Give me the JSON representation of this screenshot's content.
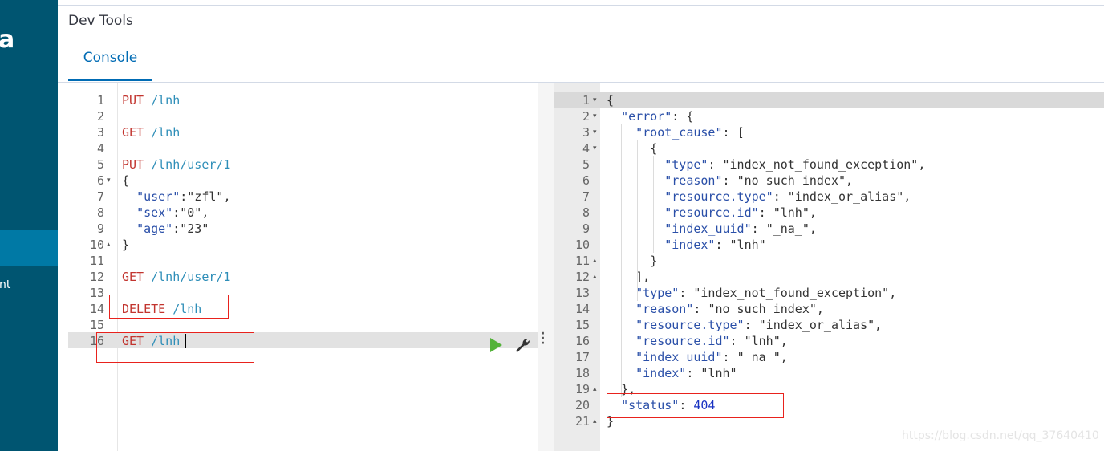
{
  "sidebar": {
    "logo_fragment": "a",
    "nav_fragment": "nt",
    "colors": {
      "background": "#005571",
      "active": "#0079a5"
    }
  },
  "header": {
    "title": "Dev Tools",
    "tabs": [
      {
        "label": "Console",
        "active": true
      }
    ],
    "accent_color": "#006bb4"
  },
  "request_editor": {
    "lines": [
      {
        "n": "1",
        "method": "PUT",
        "path": " /lnh"
      },
      {
        "n": "2"
      },
      {
        "n": "3",
        "method": "GET",
        "path": " /lnh"
      },
      {
        "n": "4"
      },
      {
        "n": "5",
        "method": "PUT",
        "path": " /lnh/user/1"
      },
      {
        "n": "6",
        "text": "{",
        "fold": "open"
      },
      {
        "n": "7",
        "text": "  \"user\":\"zfl\","
      },
      {
        "n": "8",
        "text": "  \"sex\":\"0\","
      },
      {
        "n": "9",
        "text": "  \"age\":\"23\""
      },
      {
        "n": "10",
        "text": "}",
        "fold": "close"
      },
      {
        "n": "11"
      },
      {
        "n": "12",
        "method": "GET",
        "path": " /lnh/user/1"
      },
      {
        "n": "13"
      },
      {
        "n": "14",
        "method": "DELETE",
        "path": " /lnh"
      },
      {
        "n": "15"
      },
      {
        "n": "16",
        "method": "GET",
        "path": " /lnh",
        "active": true
      }
    ],
    "actions": {
      "run_icon": "play-icon",
      "settings_icon": "wrench-icon"
    }
  },
  "response_editor": {
    "lines": [
      {
        "n": "1",
        "text": "{",
        "fold": "open"
      },
      {
        "n": "2",
        "text": "  \"error\": {",
        "fold": "open"
      },
      {
        "n": "3",
        "text": "    \"root_cause\": [",
        "fold": "open"
      },
      {
        "n": "4",
        "text": "      {",
        "fold": "open"
      },
      {
        "n": "5",
        "text": "        \"type\": \"index_not_found_exception\","
      },
      {
        "n": "6",
        "text": "        \"reason\": \"no such index\","
      },
      {
        "n": "7",
        "text": "        \"resource.type\": \"index_or_alias\","
      },
      {
        "n": "8",
        "text": "        \"resource.id\": \"lnh\","
      },
      {
        "n": "9",
        "text": "        \"index_uuid\": \"_na_\","
      },
      {
        "n": "10",
        "text": "        \"index\": \"lnh\""
      },
      {
        "n": "11",
        "text": "      }",
        "fold": "close"
      },
      {
        "n": "12",
        "text": "    ],",
        "fold": "close"
      },
      {
        "n": "13",
        "text": "    \"type\": \"index_not_found_exception\","
      },
      {
        "n": "14",
        "text": "    \"reason\": \"no such index\","
      },
      {
        "n": "15",
        "text": "    \"resource.type\": \"index_or_alias\","
      },
      {
        "n": "16",
        "text": "    \"resource.id\": \"lnh\","
      },
      {
        "n": "17",
        "text": "    \"index_uuid\": \"_na_\","
      },
      {
        "n": "18",
        "text": "    \"index\": \"lnh\""
      },
      {
        "n": "19",
        "text": "  },",
        "fold": "close"
      },
      {
        "n": "20",
        "text": "  \"status\": 404"
      },
      {
        "n": "21",
        "text": "}",
        "fold": "close"
      }
    ]
  },
  "watermark": "https://blog.csdn.net/qq_37640410",
  "annotation_color": "#e8221d"
}
